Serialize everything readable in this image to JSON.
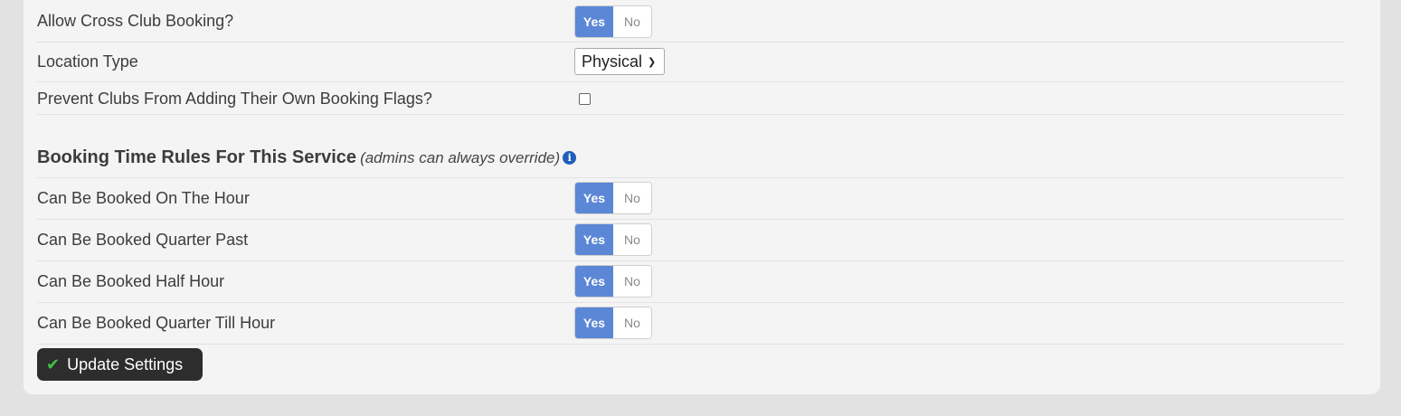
{
  "settings": {
    "cross_club": {
      "label": "Allow Cross Club Booking?",
      "yes": "Yes",
      "no": "No",
      "value": "Yes"
    },
    "location_type": {
      "label": "Location Type",
      "selected": "Physical"
    },
    "prevent_flags": {
      "label": "Prevent Clubs From Adding Their Own Booking Flags?",
      "checked": false
    }
  },
  "time_rules": {
    "title": "Booking Time Rules For This Service",
    "note": "(admins can always override)",
    "info_glyph": "i",
    "rows": [
      {
        "label": "Can Be Booked On The Hour",
        "yes": "Yes",
        "no": "No",
        "value": "Yes"
      },
      {
        "label": "Can Be Booked Quarter Past",
        "yes": "Yes",
        "no": "No",
        "value": "Yes"
      },
      {
        "label": "Can Be Booked Half Hour",
        "yes": "Yes",
        "no": "No",
        "value": "Yes"
      },
      {
        "label": "Can Be Booked Quarter Till Hour",
        "yes": "Yes",
        "no": "No",
        "value": "Yes"
      }
    ]
  },
  "actions": {
    "update_label": "Update Settings"
  },
  "icons": {
    "info": "info-icon",
    "check": "check-icon",
    "chevron": "chevron-down-icon"
  },
  "colors": {
    "toggle_active": "#5b87d6",
    "button_bg": "#2d2d2d",
    "check": "#3fc23f",
    "info": "#1f5fb8"
  }
}
